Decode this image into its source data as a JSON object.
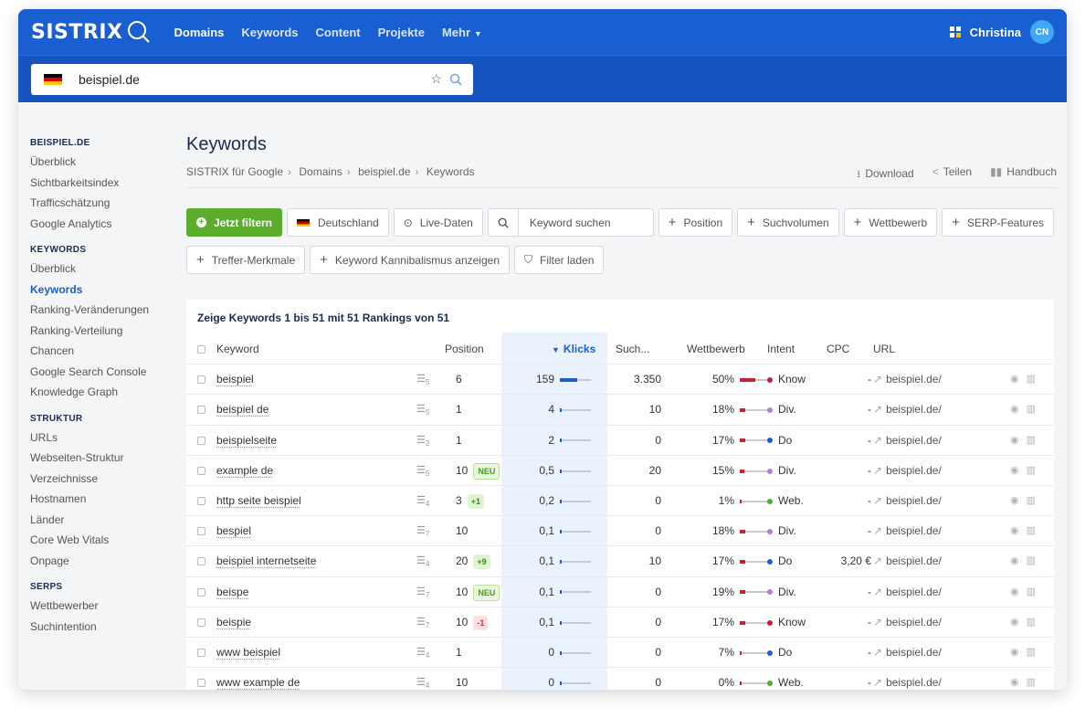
{
  "header": {
    "logo": "SISTRIX",
    "nav": [
      "Domains",
      "Keywords",
      "Content",
      "Projekte",
      "Mehr"
    ],
    "active_nav": "Domains",
    "user_name": "Christina",
    "avatar_initials": "CN"
  },
  "search": {
    "value": "beispiel.de"
  },
  "sidebar": {
    "groups": [
      {
        "heading": "BEISPIEL.DE",
        "items": [
          "Überblick",
          "Sichtbarkeitsindex",
          "Trafficschätzung",
          "Google Analytics"
        ]
      },
      {
        "heading": "KEYWORDS",
        "items": [
          "Überblick",
          "Keywords",
          "Ranking-Veränderungen",
          "Ranking-Verteilung",
          "Chancen",
          "Google Search Console",
          "Knowledge Graph"
        ]
      },
      {
        "heading": "STRUKTUR",
        "items": [
          "URLs",
          "Webseiten-Struktur",
          "Verzeichnisse",
          "Hostnamen",
          "Länder",
          "Core Web Vitals",
          "Onpage"
        ]
      },
      {
        "heading": "SERPS",
        "items": [
          "Wettbewerber",
          "Suchintention"
        ]
      }
    ],
    "active_item": "Keywords"
  },
  "page": {
    "title": "Keywords",
    "breadcrumb": [
      "SISTRIX für Google",
      "Domains",
      "beispiel.de",
      "Keywords"
    ],
    "actions": {
      "download": "Download",
      "share": "Teilen",
      "manual": "Handbuch"
    }
  },
  "filters": {
    "apply": "Jetzt filtern",
    "country": "Deutschland",
    "live": "Live-Daten",
    "search_placeholder": "Keyword suchen",
    "position": "Position",
    "volume": "Suchvolumen",
    "competition": "Wettbewerb",
    "serp_features": "SERP-Features",
    "hit_features": "Treffer-Merkmale",
    "cannibalism": "Keyword Kannibalismus anzeigen",
    "load_filter": "Filter laden"
  },
  "table": {
    "summary": "Zeige Keywords 1 bis 51 mit 51 Rankings von 51",
    "columns": {
      "keyword": "Keyword",
      "position": "Position",
      "clicks": "Klicks",
      "volume": "Such...",
      "competition": "Wettbewerb",
      "intent": "Intent",
      "cpc": "CPC",
      "url": "URL"
    },
    "intent_colors": {
      "Know": "#c8203a",
      "Div.": "#b57bd8",
      "Do": "#1a5fd1",
      "Web.": "#4cae2a"
    },
    "rows": [
      {
        "keyword": "beispiel",
        "serp": "5",
        "position": "6",
        "badge": "",
        "badge_type": "",
        "clicks": "159",
        "clicks_ratio": 0.55,
        "volume": "3.350",
        "competition": "50%",
        "competition_ratio": 0.5,
        "intent": "Know",
        "cpc": "-",
        "url": "beispiel.de/"
      },
      {
        "keyword": "beispiel de",
        "serp": "5",
        "position": "1",
        "badge": "",
        "badge_type": "",
        "clicks": "4",
        "clicks_ratio": 0.03,
        "volume": "10",
        "competition": "18%",
        "competition_ratio": 0.18,
        "intent": "Div.",
        "cpc": "-",
        "url": "beispiel.de/"
      },
      {
        "keyword": "beispielseite",
        "serp": "2",
        "position": "1",
        "badge": "",
        "badge_type": "",
        "clicks": "2",
        "clicks_ratio": 0.02,
        "volume": "0",
        "competition": "17%",
        "competition_ratio": 0.17,
        "intent": "Do",
        "cpc": "-",
        "url": "beispiel.de/"
      },
      {
        "keyword": "example de",
        "serp": "5",
        "position": "10",
        "badge": "NEU",
        "badge_type": "new",
        "clicks": "0,5",
        "clicks_ratio": 0.01,
        "volume": "20",
        "competition": "15%",
        "competition_ratio": 0.15,
        "intent": "Div.",
        "cpc": "-",
        "url": "beispiel.de/"
      },
      {
        "keyword": "http seite beispiel",
        "serp": "4",
        "position": "3",
        "badge": "+1",
        "badge_type": "up",
        "clicks": "0,2",
        "clicks_ratio": 0.01,
        "volume": "0",
        "competition": "1%",
        "competition_ratio": 0.01,
        "intent": "Web.",
        "cpc": "-",
        "url": "beispiel.de/"
      },
      {
        "keyword": "bespiel",
        "serp": "7",
        "position": "10",
        "badge": "",
        "badge_type": "",
        "clicks": "0,1",
        "clicks_ratio": 0.01,
        "volume": "0",
        "competition": "18%",
        "competition_ratio": 0.18,
        "intent": "Div.",
        "cpc": "-",
        "url": "beispiel.de/"
      },
      {
        "keyword": "beispiel internetseite",
        "serp": "4",
        "position": "20",
        "badge": "+9",
        "badge_type": "up",
        "clicks": "0,1",
        "clicks_ratio": 0.01,
        "volume": "10",
        "competition": "17%",
        "competition_ratio": 0.17,
        "intent": "Do",
        "cpc": "3,20 €",
        "url": "beispiel.de/"
      },
      {
        "keyword": "beispe",
        "serp": "7",
        "position": "10",
        "badge": "NEU",
        "badge_type": "new",
        "clicks": "0,1",
        "clicks_ratio": 0.01,
        "volume": "0",
        "competition": "19%",
        "competition_ratio": 0.19,
        "intent": "Div.",
        "cpc": "-",
        "url": "beispiel.de/"
      },
      {
        "keyword": "beispie",
        "serp": "7",
        "position": "10",
        "badge": "-1",
        "badge_type": "down",
        "clicks": "0,1",
        "clicks_ratio": 0.01,
        "volume": "0",
        "competition": "17%",
        "competition_ratio": 0.17,
        "intent": "Know",
        "cpc": "-",
        "url": "beispiel.de/"
      },
      {
        "keyword": "www beispiel",
        "serp": "4",
        "position": "1",
        "badge": "",
        "badge_type": "",
        "clicks": "0",
        "clicks_ratio": 0.0,
        "volume": "0",
        "competition": "7%",
        "competition_ratio": 0.07,
        "intent": "Do",
        "cpc": "-",
        "url": "beispiel.de/"
      },
      {
        "keyword": "www example de",
        "serp": "4",
        "position": "10",
        "badge": "",
        "badge_type": "",
        "clicks": "0",
        "clicks_ratio": 0.0,
        "volume": "0",
        "competition": "0%",
        "competition_ratio": 0.0,
        "intent": "Web.",
        "cpc": "-",
        "url": "beispiel.de/"
      }
    ]
  }
}
